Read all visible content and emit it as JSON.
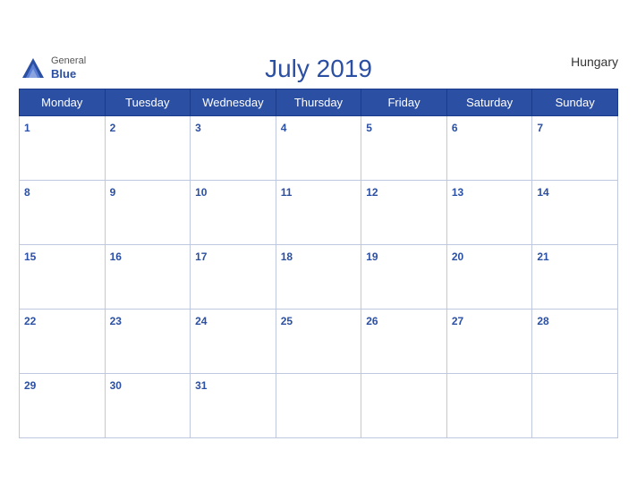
{
  "calendar": {
    "title": "July 2019",
    "country": "Hungary",
    "month": "July",
    "year": "2019",
    "days_of_week": [
      "Monday",
      "Tuesday",
      "Wednesday",
      "Thursday",
      "Friday",
      "Saturday",
      "Sunday"
    ],
    "weeks": [
      [
        {
          "date": "1",
          "empty": false
        },
        {
          "date": "2",
          "empty": false
        },
        {
          "date": "3",
          "empty": false
        },
        {
          "date": "4",
          "empty": false
        },
        {
          "date": "5",
          "empty": false
        },
        {
          "date": "6",
          "empty": false
        },
        {
          "date": "7",
          "empty": false
        }
      ],
      [
        {
          "date": "8",
          "empty": false
        },
        {
          "date": "9",
          "empty": false
        },
        {
          "date": "10",
          "empty": false
        },
        {
          "date": "11",
          "empty": false
        },
        {
          "date": "12",
          "empty": false
        },
        {
          "date": "13",
          "empty": false
        },
        {
          "date": "14",
          "empty": false
        }
      ],
      [
        {
          "date": "15",
          "empty": false
        },
        {
          "date": "16",
          "empty": false
        },
        {
          "date": "17",
          "empty": false
        },
        {
          "date": "18",
          "empty": false
        },
        {
          "date": "19",
          "empty": false
        },
        {
          "date": "20",
          "empty": false
        },
        {
          "date": "21",
          "empty": false
        }
      ],
      [
        {
          "date": "22",
          "empty": false
        },
        {
          "date": "23",
          "empty": false
        },
        {
          "date": "24",
          "empty": false
        },
        {
          "date": "25",
          "empty": false
        },
        {
          "date": "26",
          "empty": false
        },
        {
          "date": "27",
          "empty": false
        },
        {
          "date": "28",
          "empty": false
        }
      ],
      [
        {
          "date": "29",
          "empty": false
        },
        {
          "date": "30",
          "empty": false
        },
        {
          "date": "31",
          "empty": false
        },
        {
          "date": "",
          "empty": true
        },
        {
          "date": "",
          "empty": true
        },
        {
          "date": "",
          "empty": true
        },
        {
          "date": "",
          "empty": true
        }
      ]
    ]
  },
  "logo": {
    "general": "General",
    "blue": "Blue"
  }
}
